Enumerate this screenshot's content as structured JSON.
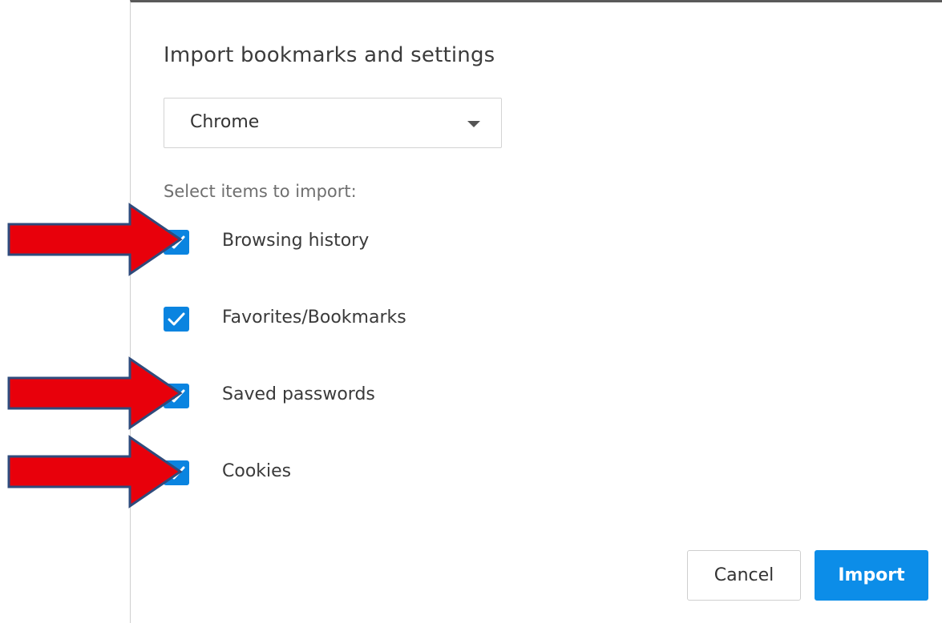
{
  "dialog": {
    "title": "Import bookmarks and settings",
    "browser_select": {
      "selected": "Chrome",
      "icon": "chevron-down-icon"
    },
    "section_label": "Select items to import:",
    "options": [
      {
        "label": "Browsing history",
        "checked": true
      },
      {
        "label": "Favorites/Bookmarks",
        "checked": true
      },
      {
        "label": "Saved passwords",
        "checked": true
      },
      {
        "label": "Cookies",
        "checked": true
      }
    ],
    "buttons": {
      "cancel": "Cancel",
      "import": "Import"
    }
  },
  "annotations": {
    "arrow_color": "#e8000b",
    "arrow_outline": "#2f4b7c",
    "highlighted_options": [
      "Browsing history",
      "Saved passwords",
      "Cookies"
    ]
  },
  "colors": {
    "accent": "#0a84e0",
    "primary_button": "#0c8de8"
  }
}
